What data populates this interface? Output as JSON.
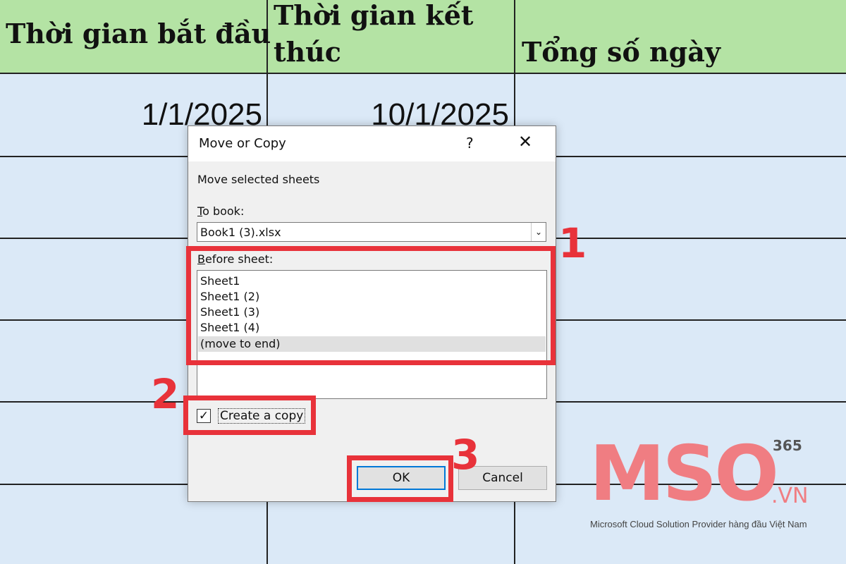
{
  "sheet": {
    "headers": [
      "Thời gian bắt đầu",
      "Thời gian kết thúc",
      "Tổng số ngày"
    ],
    "row1": {
      "start": "1/1/2025",
      "end": "10/1/2025"
    }
  },
  "dialog": {
    "title": "Move or Copy",
    "help": "?",
    "close": "✕",
    "move_label": "Move selected sheets",
    "to_book_label_accel": "T",
    "to_book_label_rest": "o book:",
    "to_book_value": "Book1 (3).xlsx",
    "combo_arrow": "⌄",
    "before_sheet_accel": "B",
    "before_sheet_rest": "efore sheet:",
    "sheets": [
      "Sheet1",
      "Sheet1 (2)",
      "Sheet1 (3)",
      "Sheet1 (4)",
      "(move to end)"
    ],
    "create_copy_checked": "✓",
    "create_copy_label": "Create a copy",
    "ok_label": "OK",
    "cancel_label": "Cancel"
  },
  "annotations": {
    "n1": "1",
    "n2": "2",
    "n3": "3",
    "color": "#e8323a"
  },
  "logo": {
    "main": "MSO",
    "sup": "365",
    "suffix": ".VN",
    "tagline": "Microsoft Cloud Solution Provider hàng đầu Việt Nam"
  }
}
